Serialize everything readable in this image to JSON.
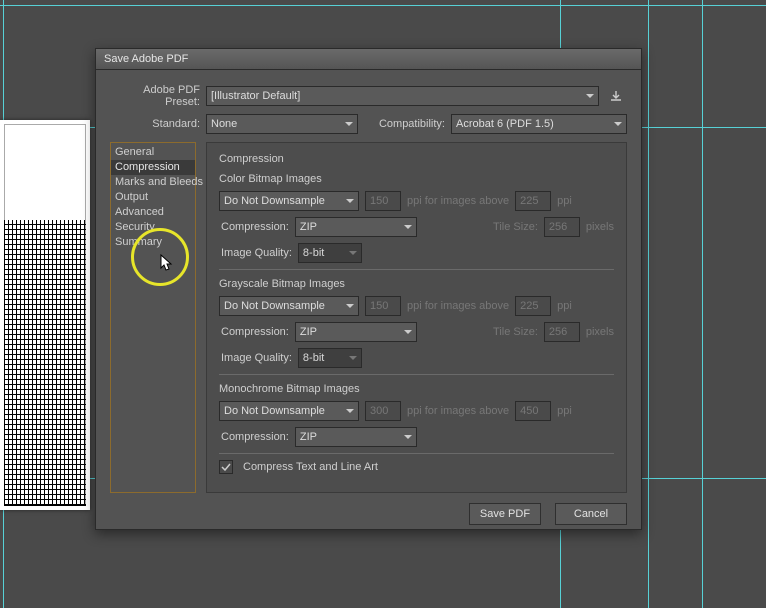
{
  "dialog": {
    "title": "Save Adobe PDF",
    "preset": {
      "label": "Adobe PDF Preset:",
      "value": "[Illustrator Default]"
    },
    "standard": {
      "label": "Standard:",
      "value": "None"
    },
    "compatibility": {
      "label": "Compatibility:",
      "value": "Acrobat 6 (PDF 1.5)"
    }
  },
  "sidebar": {
    "items": [
      "General",
      "Compression",
      "Marks and Bleeds",
      "Output",
      "Advanced",
      "Security",
      "Summary"
    ],
    "selected_index": 1
  },
  "panel": {
    "title": "Compression",
    "color": {
      "title": "Color Bitmap Images",
      "downsample": "Do Not Downsample",
      "ppi": "150",
      "above_label": "ppi for images above",
      "above": "225",
      "above_unit": "ppi",
      "compression_label": "Compression:",
      "compression": "ZIP",
      "tile_label": "Tile Size:",
      "tile": "256",
      "tile_unit": "pixels",
      "quality_label": "Image Quality:",
      "quality": "8-bit"
    },
    "gray": {
      "title": "Grayscale Bitmap Images",
      "downsample": "Do Not Downsample",
      "ppi": "150",
      "above_label": "ppi for images above",
      "above": "225",
      "above_unit": "ppi",
      "compression_label": "Compression:",
      "compression": "ZIP",
      "tile_label": "Tile Size:",
      "tile": "256",
      "tile_unit": "pixels",
      "quality_label": "Image Quality:",
      "quality": "8-bit"
    },
    "mono": {
      "title": "Monochrome Bitmap Images",
      "downsample": "Do Not Downsample",
      "ppi": "300",
      "above_label": "ppi for images above",
      "above": "450",
      "above_unit": "ppi",
      "compression_label": "Compression:",
      "compression": "ZIP"
    },
    "compress_text": {
      "checked": true,
      "label": "Compress Text and Line Art"
    }
  },
  "buttons": {
    "save": "Save PDF",
    "cancel": "Cancel"
  }
}
